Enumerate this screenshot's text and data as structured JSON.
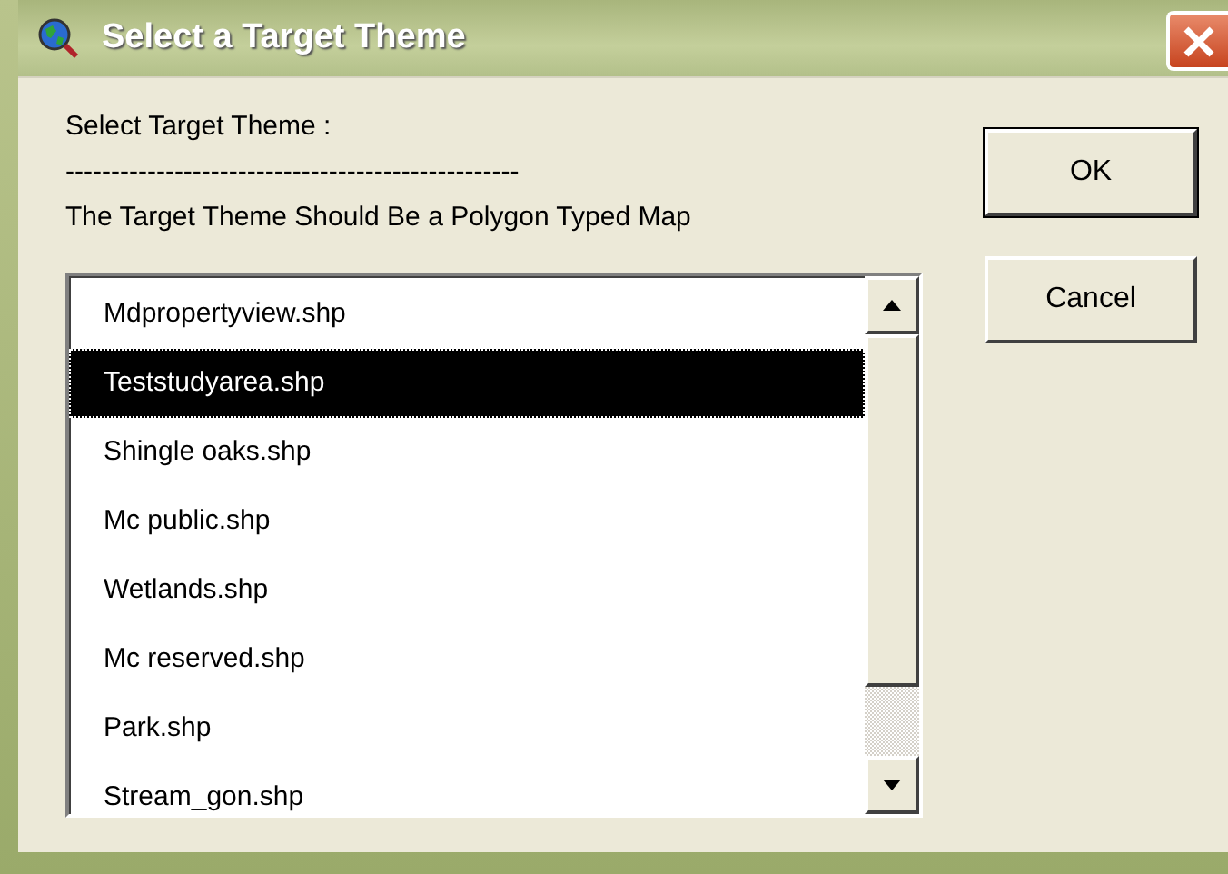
{
  "window": {
    "title": "Select a Target Theme"
  },
  "prompt": "Select Target Theme :",
  "separator": "--------------------------------------------------",
  "message": "The Target Theme Should Be a Polygon Typed Map",
  "list": [
    {
      "label": "Mdpropertyview.shp",
      "selected": false
    },
    {
      "label": "Teststudyarea.shp",
      "selected": true
    },
    {
      "label": "Shingle oaks.shp",
      "selected": false
    },
    {
      "label": "Mc public.shp",
      "selected": false
    },
    {
      "label": "Wetlands.shp",
      "selected": false
    },
    {
      "label": "Mc reserved.shp",
      "selected": false
    },
    {
      "label": "Park.shp",
      "selected": false
    },
    {
      "label": "Stream_gon.shp",
      "selected": false
    }
  ],
  "buttons": [
    "OK",
    "Cancel"
  ]
}
